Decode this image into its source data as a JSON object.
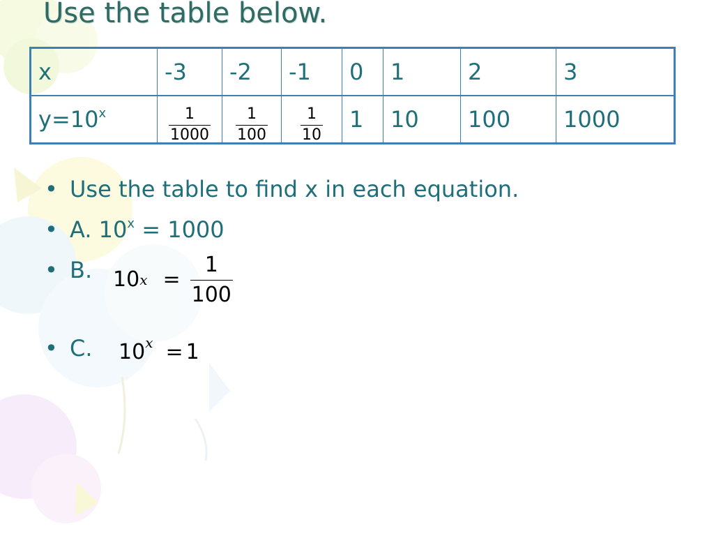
{
  "title": "Use the table below.",
  "table": {
    "x_header": "x",
    "y_header": "y=10",
    "y_header_exp": "x",
    "x_values": [
      "-3",
      "-2",
      "-1",
      "0",
      "1",
      "2",
      "3"
    ],
    "y_fractions": [
      {
        "num": "1",
        "den": "1000"
      },
      {
        "num": "1",
        "den": "100"
      },
      {
        "num": "1",
        "den": "10"
      }
    ],
    "y_values": [
      "1",
      "10",
      "100",
      "1000"
    ]
  },
  "bullets": {
    "dot": "•",
    "intro": "Use the table to find x in each equation.",
    "a_prefix": "A. 10",
    "a_exp": "x",
    "a_suffix": " = 1000",
    "b_label": "B.",
    "c_label": "C."
  },
  "equations": {
    "b": {
      "base": "10",
      "exp": "x",
      "rel": "=",
      "num": "1",
      "den": "100"
    },
    "c": {
      "base": "10",
      "exp": "x",
      "rel": "=",
      "rhs": "1"
    }
  },
  "colors": {
    "title": "#2e6b63",
    "body_text": "#1f6f7a",
    "table_border": "#3f7fb7"
  }
}
